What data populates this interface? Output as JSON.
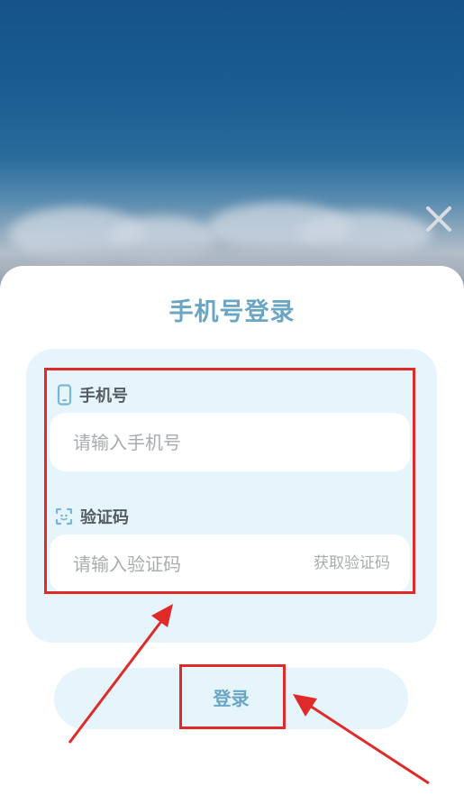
{
  "title": "手机号登录",
  "phone": {
    "label": "手机号",
    "placeholder": "请输入手机号",
    "icon": "phone-icon"
  },
  "code": {
    "label": "验证码",
    "placeholder": "请输入验证码",
    "icon": "verification-code-icon",
    "get_code_label": "获取验证码"
  },
  "login_label": "登录",
  "colors": {
    "accent": "#6aa6c4",
    "panel": "#e6f5fc",
    "highlight": "#e02a2a"
  }
}
